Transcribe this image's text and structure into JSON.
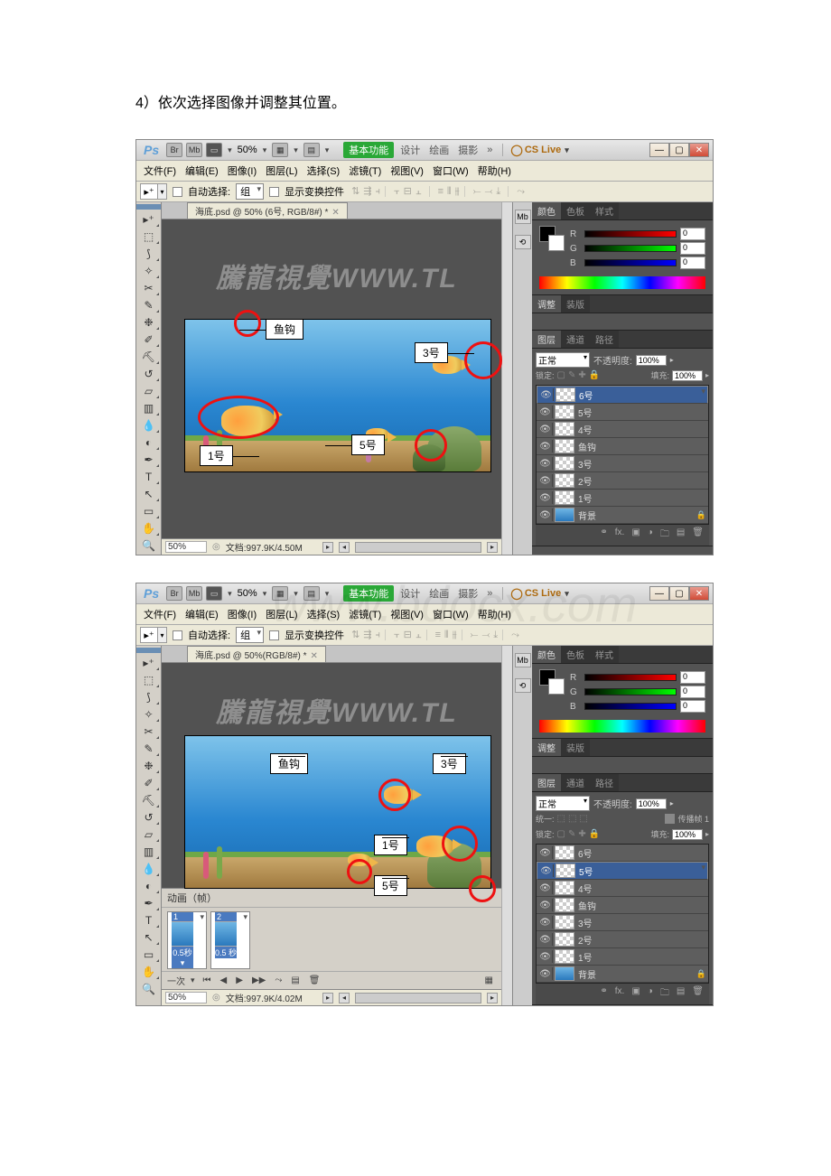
{
  "instruction_text": "4）依次选择图像并调整其位置。",
  "app": {
    "logo": "Ps",
    "zoom": "50%",
    "workspace_tab": "基本功能",
    "workspace_links": [
      "设计",
      "绘画",
      "摄影"
    ],
    "more": "»",
    "cslive": "CS Live",
    "win_min": "—",
    "win_max": "▢",
    "win_close": "✕"
  },
  "menu": {
    "file": "文件(F)",
    "edit": "编辑(E)",
    "image": "图像(I)",
    "layer": "图层(L)",
    "select": "选择(S)",
    "filter": "滤镜(T)",
    "view": "视图(V)",
    "window": "窗口(W)",
    "help": "帮助(H)"
  },
  "options": {
    "auto_sel_label": "自动选择:",
    "auto_sel_value": "组",
    "show_transform": "显示变换控件"
  },
  "doc1": {
    "tab": "海底.psd @ 50% (6号, RGB/8#) *",
    "status_doc": "文档:997.9K/4.50M",
    "status_zoom": "50%"
  },
  "doc2": {
    "tab": "海底.psd @ 50%(RGB/8#) *",
    "status_doc": "文档:997.9K/4.02M",
    "status_zoom": "50%"
  },
  "callouts": {
    "yugou": "鱼钩",
    "no3": "3号",
    "no5": "5号",
    "no1": "1号"
  },
  "color_panel": {
    "tabs": [
      "颜色",
      "色板",
      "样式"
    ],
    "r": "0",
    "g": "0",
    "b": "0"
  },
  "adjust_panel": {
    "tabs": [
      "调整",
      "装版"
    ]
  },
  "layers_panel": {
    "tabs": [
      "图层",
      "通道",
      "路径"
    ],
    "blend": "正常",
    "opacity_label": "不透明度:",
    "opacity": "100%",
    "fill_label": "填充:",
    "fill": "100%",
    "lock_label": "锁定:",
    "extra_label": "统一:",
    "propagate": "传播帧 1",
    "layers": [
      {
        "name": "6号",
        "sel": true
      },
      {
        "name": "5号"
      },
      {
        "name": "4号"
      },
      {
        "name": "鱼钩"
      },
      {
        "name": "3号"
      },
      {
        "name": "2号"
      },
      {
        "name": "1号"
      },
      {
        "name": "背景",
        "bg": true,
        "locked": true
      }
    ],
    "layers2": [
      {
        "name": "6号"
      },
      {
        "name": "5号",
        "sel": true
      },
      {
        "name": "4号"
      },
      {
        "name": "鱼钩"
      },
      {
        "name": "3号"
      },
      {
        "name": "2号"
      },
      {
        "name": "1号"
      },
      {
        "name": "背景",
        "bg": true,
        "locked": true
      }
    ]
  },
  "animation": {
    "title": "动画（帧）",
    "frames": [
      {
        "n": "1",
        "d": "0.5秒▾"
      },
      {
        "n": "2",
        "d": "0.5 秒"
      }
    ],
    "loop": "一次"
  },
  "watermark": "騰龍視覺WWW.TL",
  "bg_watermark": "www.bdocx.com"
}
